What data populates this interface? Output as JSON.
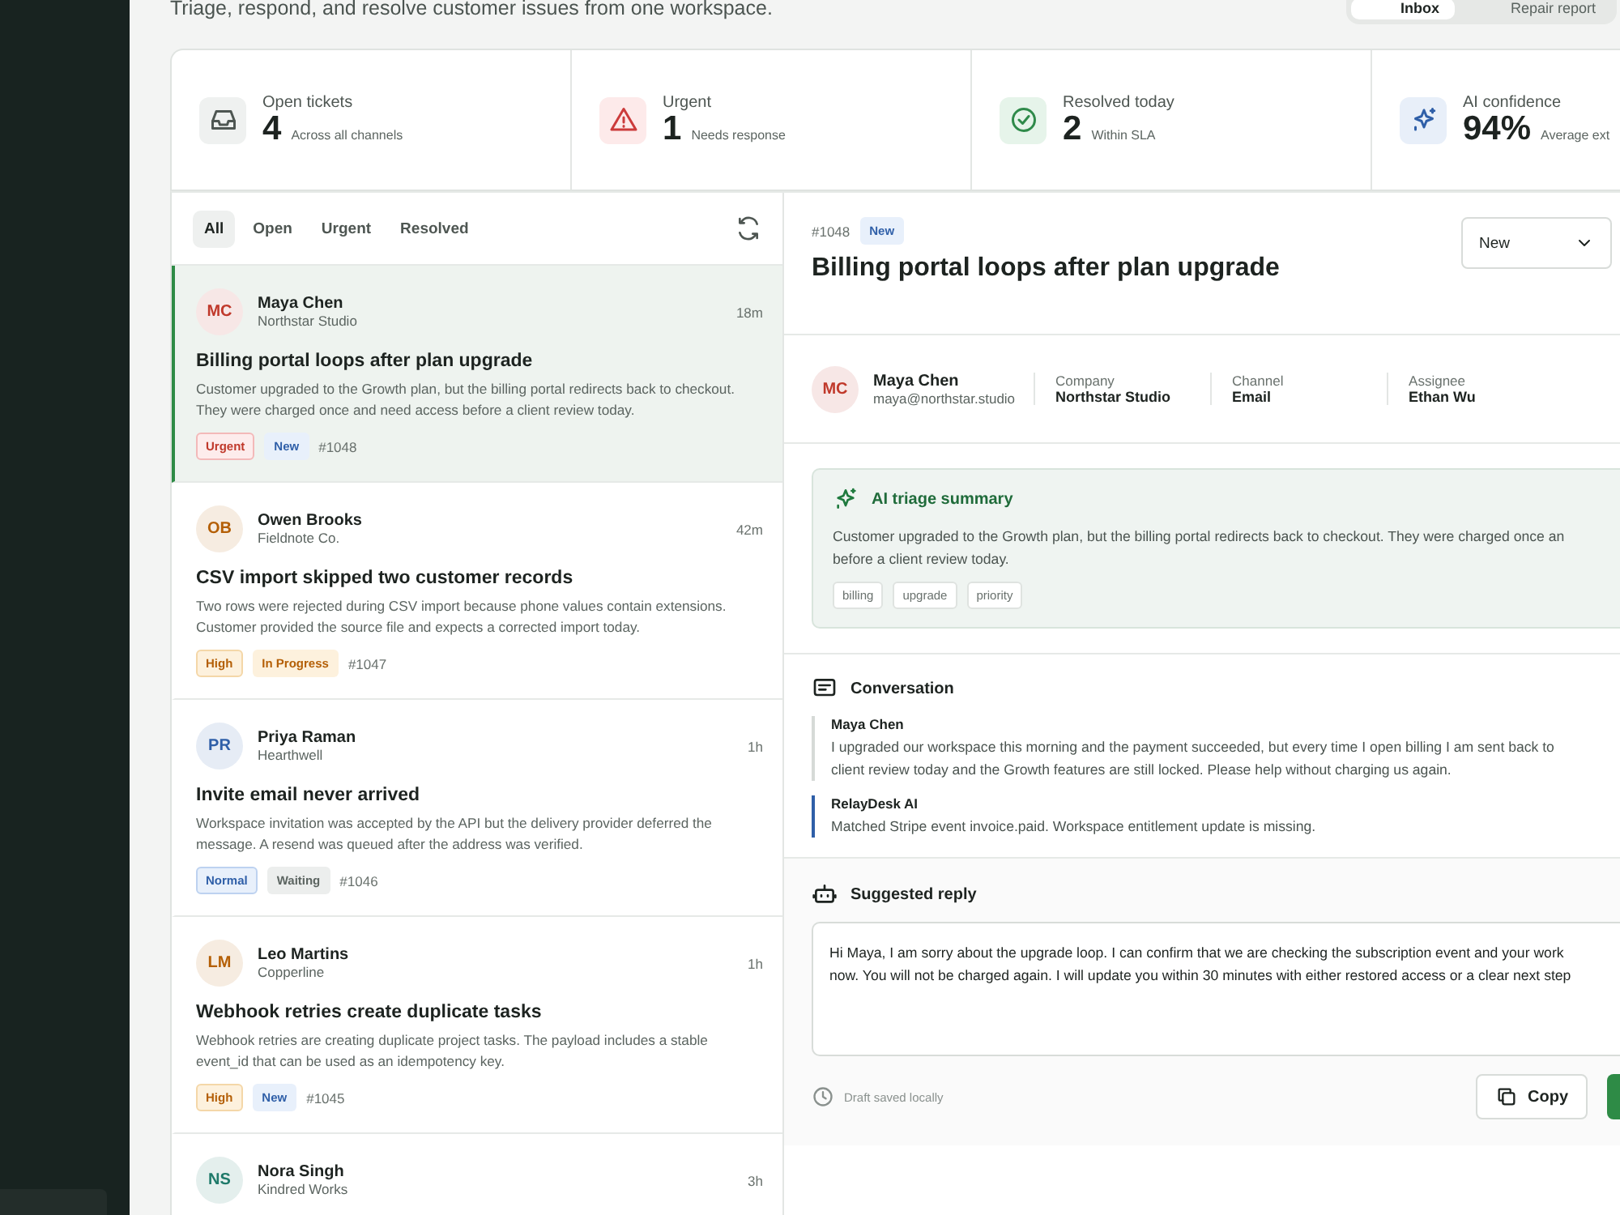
{
  "header": {
    "subtitle": "Triage, respond, and resolve customer issues from one workspace.",
    "views": [
      {
        "label": "Inbox",
        "selected": true
      },
      {
        "label": "Repair report",
        "selected": false
      }
    ]
  },
  "stats": [
    {
      "label": "Open tickets",
      "value": "4",
      "note": "Across all channels"
    },
    {
      "label": "Urgent",
      "value": "1",
      "note": "Needs response"
    },
    {
      "label": "Resolved today",
      "value": "2",
      "note": "Within SLA"
    },
    {
      "label": "AI confidence",
      "value": "94%",
      "note": "Average ext"
    }
  ],
  "filters": [
    {
      "label": "All",
      "selected": true
    },
    {
      "label": "Open",
      "selected": false
    },
    {
      "label": "Urgent",
      "selected": false
    },
    {
      "label": "Resolved",
      "selected": false
    }
  ],
  "tickets": [
    {
      "initials": "MC",
      "color": "#c0392b",
      "name": "Maya Chen",
      "company": "Northstar Studio",
      "time": "18m",
      "title": "Billing portal loops after plan upgrade",
      "summary": "Customer upgraded to the Growth plan, but the billing portal redirects back to checkout. They were charged once and need access before a client review today.",
      "tags": [
        {
          "label": "Urgent",
          "kind": "urgent"
        },
        {
          "label": "New",
          "kind": "new"
        }
      ],
      "id": "#1048",
      "selected": true
    },
    {
      "initials": "OB",
      "color": "#b45f06",
      "name": "Owen Brooks",
      "company": "Fieldnote Co.",
      "time": "42m",
      "title": "CSV import skipped two customer records",
      "summary": "Two rows were rejected during CSV import because phone values contain extensions. Customer provided the source file and expects a corrected import today.",
      "tags": [
        {
          "label": "High",
          "kind": "high"
        },
        {
          "label": "In Progress",
          "kind": "progress"
        }
      ],
      "id": "#1047",
      "selected": false
    },
    {
      "initials": "PR",
      "color": "#2f5fa8",
      "name": "Priya Raman",
      "company": "Hearthwell",
      "time": "1h",
      "title": "Invite email never arrived",
      "summary": "Workspace invitation was accepted by the API but the delivery provider deferred the message. A resend was queued after the address was verified.",
      "tags": [
        {
          "label": "Normal",
          "kind": "normal"
        },
        {
          "label": "Waiting",
          "kind": "waiting"
        }
      ],
      "id": "#1046",
      "selected": false
    },
    {
      "initials": "LM",
      "color": "#b45f06",
      "name": "Leo Martins",
      "company": "Copperline",
      "time": "1h",
      "title": "Webhook retries create duplicate tasks",
      "summary": "Webhook retries are creating duplicate project tasks. The payload includes a stable event_id that can be used as an idempotency key.",
      "tags": [
        {
          "label": "High",
          "kind": "high"
        },
        {
          "label": "New",
          "kind": "new"
        }
      ],
      "id": "#1045",
      "selected": false
    },
    {
      "initials": "NS",
      "color": "#1f7a6a",
      "name": "Nora Singh",
      "company": "Kindred Works",
      "time": "3h",
      "selected": false
    }
  ],
  "detail": {
    "id": "#1048",
    "status_badge": "New",
    "title": "Billing portal loops after plan upgrade",
    "status_select": "New",
    "contact": {
      "initials": "MC",
      "color": "#c0392b",
      "name": "Maya Chen",
      "email": "maya@northstar.studio"
    },
    "fields": [
      {
        "label": "Company",
        "value": "Northstar Studio"
      },
      {
        "label": "Channel",
        "value": "Email"
      },
      {
        "label": "Assignee",
        "value": "Ethan Wu"
      }
    ],
    "summary": {
      "title": "AI triage summary",
      "lines": [
        "Customer upgraded to the Growth plan, but the billing portal redirects back to checkout. They were charged once an",
        "before a client review today."
      ],
      "tags": [
        "billing",
        "upgrade",
        "priority"
      ]
    },
    "conversation": {
      "title": "Conversation",
      "messages": [
        {
          "author": "Maya Chen",
          "kind": "customer",
          "lines": [
            "I upgraded our workspace this morning and the payment succeeded, but every time I open billing I am sent back to",
            "client review today and the Growth features are still locked. Please help without charging us again."
          ]
        },
        {
          "author": "RelayDesk AI",
          "kind": "ai",
          "lines": [
            "Matched Stripe event invoice.paid. Workspace entitlement update is missing."
          ]
        }
      ]
    },
    "reply": {
      "title": "Suggested reply",
      "lines": [
        "Hi Maya, I am sorry about the upgrade loop. I can confirm that we are checking the subscription event and your work",
        "now. You will not be charged again. I will update you within 30 minutes with either restored access or a clear next step"
      ],
      "draft_note": "Draft saved locally",
      "copy": "Copy"
    }
  }
}
